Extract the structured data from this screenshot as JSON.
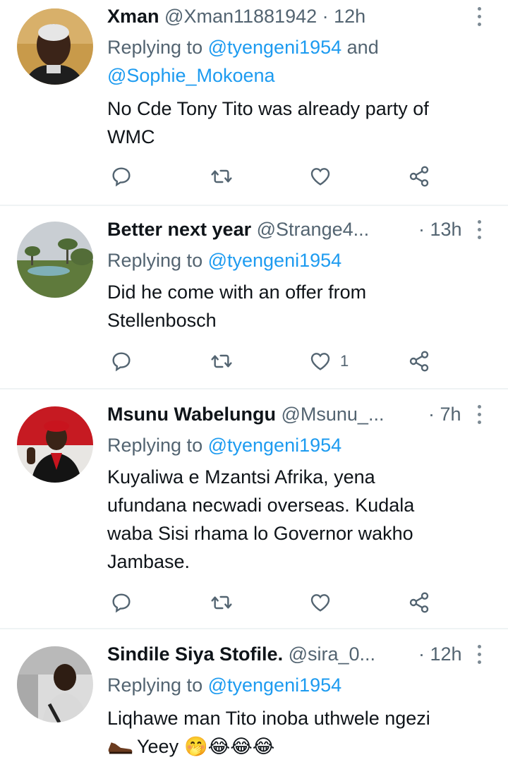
{
  "tweets": [
    {
      "name": "Xman",
      "handle": "@Xman11881942",
      "time": "· 12h",
      "replying_prefix": "Replying to ",
      "mention1": "@tyengeni1954",
      "and": " and",
      "mention2": "@Sophie_Mokoena",
      "text_line1": "No Cde Tony Tito was already party of",
      "text_line2": "WMC",
      "like_count": ""
    },
    {
      "name": "Better next year",
      "handle": "@Strange4...",
      "time": "· 13h",
      "replying_prefix": "Replying to ",
      "mention1": "@tyengeni1954",
      "text_line1": "Did he come with an offer from",
      "text_line2": "Stellenbosch",
      "like_count": "1"
    },
    {
      "name": "Msunu Wabelungu",
      "handle": "@Msunu_...",
      "time": "· 7h",
      "replying_prefix": "Replying to ",
      "mention1": "@tyengeni1954",
      "text_line1": "Kuyaliwa e Mzantsi Afrika, yena",
      "text_line2": "ufundana necwadi overseas. Kudala",
      "text_line3": "waba Sisi rhama lo Governor wakho",
      "text_line4": "Jambase.",
      "like_count": ""
    },
    {
      "name": "Sindile Siya Stofile.",
      "handle": "@sira_0...",
      "time": "· 12h",
      "replying_prefix": "Replying to ",
      "mention1": "@tyengeni1954",
      "text_line1": "Liqhawe man Tito inoba uthwele ngezi",
      "text_line2": "Yeey",
      "emojis": "🤭😂😂😂"
    }
  ],
  "icons": [
    "reply-icon",
    "retweet-icon",
    "like-icon",
    "share-icon",
    "more-icon",
    "shoe-emoji"
  ],
  "colors": {
    "link": "#1d9bf0",
    "secondary": "#536471",
    "text": "#0f1419",
    "divider": "#eff3f4"
  }
}
